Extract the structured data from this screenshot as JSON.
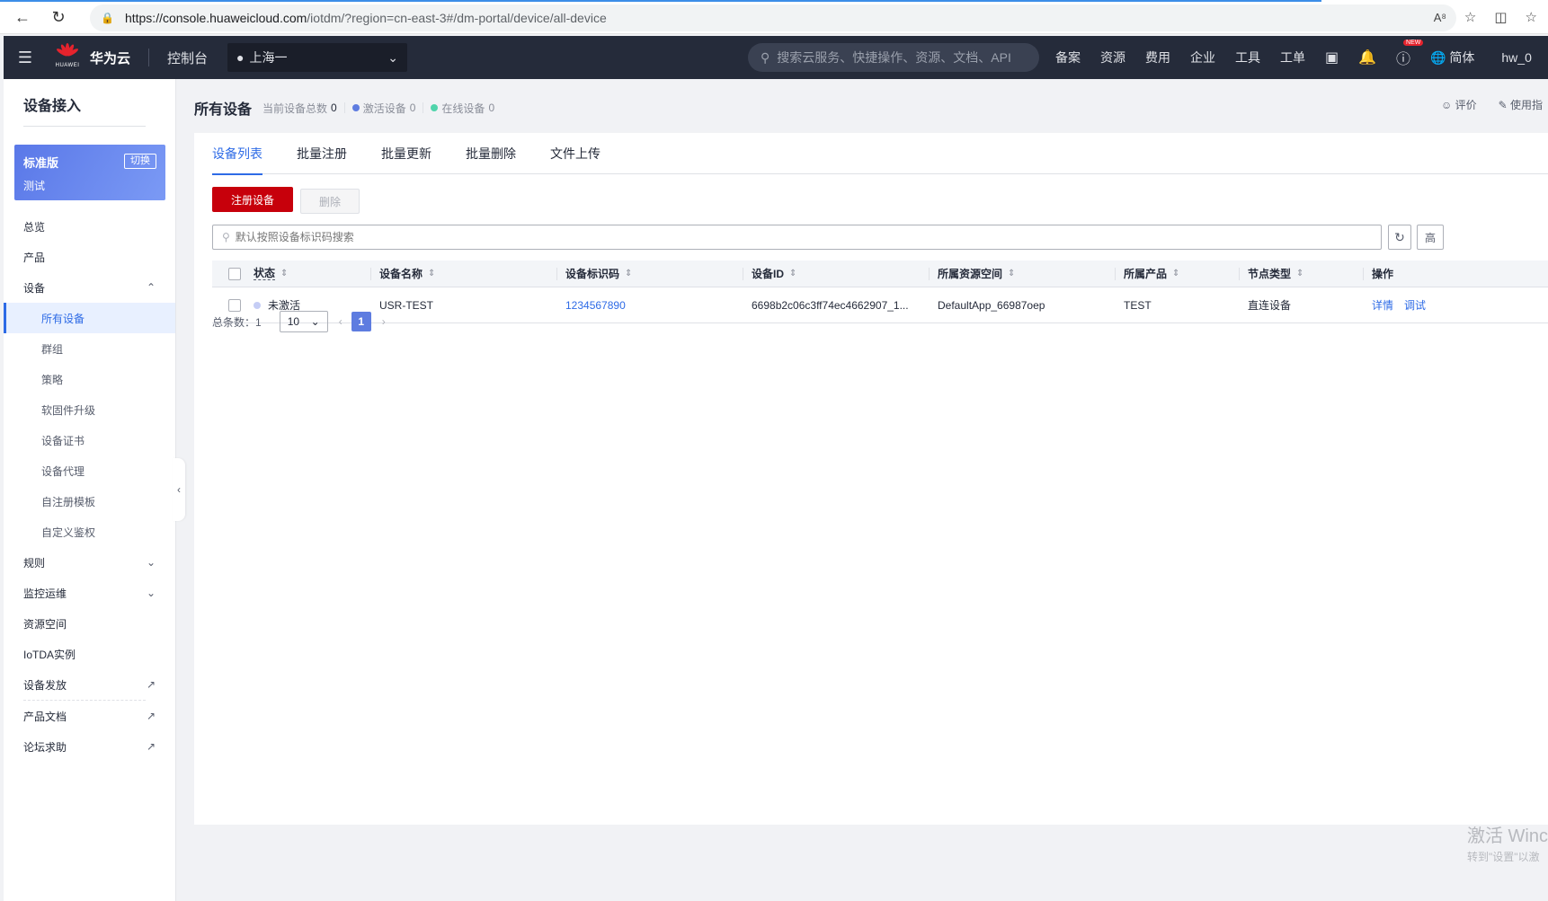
{
  "browser": {
    "url_host": "https://console.huaweicloud.com",
    "url_path": "/iotdm/?region=cn-east-3#/dm-portal/device/all-device"
  },
  "header": {
    "brand": "华为云",
    "logo_caption": "HUAWEI",
    "console": "控制台",
    "region": "上海一",
    "search_placeholder": "搜索云服务、快捷操作、资源、文档、API",
    "nav": [
      "备案",
      "资源",
      "费用",
      "企业",
      "工具",
      "工单"
    ],
    "new_badge": "NEW",
    "language": "简体",
    "user": "hw_0"
  },
  "sidebar": {
    "title": "设备接入",
    "edition": {
      "name": "标准版",
      "sub": "测试",
      "switch": "切换"
    },
    "items": [
      {
        "label": "总览"
      },
      {
        "label": "产品"
      },
      {
        "label": "设备"
      },
      {
        "label": "所有设备"
      },
      {
        "label": "群组"
      },
      {
        "label": "策略"
      },
      {
        "label": "软固件升级"
      },
      {
        "label": "设备证书"
      },
      {
        "label": "设备代理"
      },
      {
        "label": "自注册模板"
      },
      {
        "label": "自定义鉴权"
      },
      {
        "label": "规则"
      },
      {
        "label": "监控运维"
      },
      {
        "label": "资源空间"
      },
      {
        "label": "IoTDA实例"
      },
      {
        "label": "设备发放"
      },
      {
        "label": "产品文档"
      },
      {
        "label": "论坛求助"
      }
    ]
  },
  "page": {
    "title": "所有设备",
    "stats": {
      "total_label": "当前设备总数",
      "total": "0",
      "active_label": "激活设备",
      "active": "0",
      "online_label": "在线设备",
      "online": "0"
    },
    "rate": "评价",
    "guide": "使用指"
  },
  "tabs": [
    "设备列表",
    "批量注册",
    "批量更新",
    "批量删除",
    "文件上传"
  ],
  "actions": {
    "register": "注册设备",
    "delete": "删除"
  },
  "search": {
    "placeholder": "默认按照设备标识码搜索",
    "advanced": "高"
  },
  "table": {
    "columns": [
      "状态",
      "设备名称",
      "设备标识码",
      "设备ID",
      "所属资源空间",
      "所属产品",
      "节点类型",
      "操作"
    ],
    "rows": [
      {
        "status": "未激活",
        "name": "USR-TEST",
        "code": "1234567890",
        "id": "6698b2c06c3ff74ec4662907_1...",
        "space": "DefaultApp_66987oep",
        "product": "TEST",
        "node": "直连设备",
        "ops": [
          "详情",
          "调试"
        ]
      }
    ]
  },
  "pager": {
    "total_label": "总条数：1",
    "size": "10",
    "page": "1"
  },
  "watermark": {
    "line1": "激活 Winc",
    "line2": "转到\"设置\"以激"
  },
  "colors": {
    "accent": "#2e6be6",
    "primary_button": "#c7000b",
    "header_bg": "#252b3a",
    "page_active": "#5e7ce0"
  }
}
